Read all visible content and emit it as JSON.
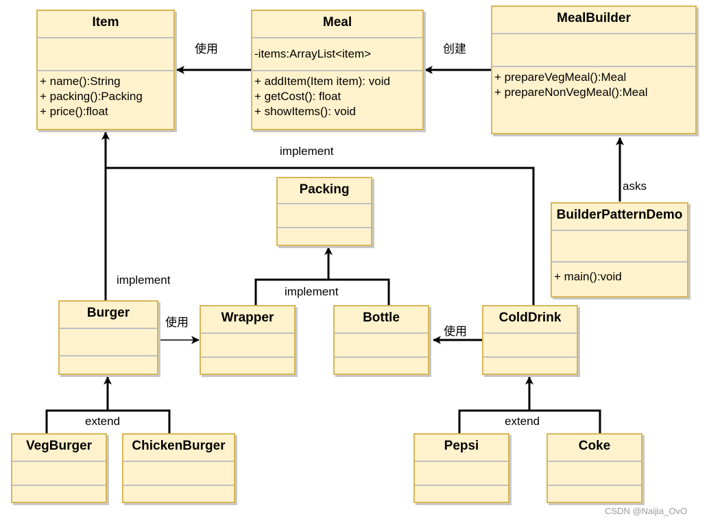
{
  "diagram": {
    "type": "UML class diagram",
    "colors": {
      "class_fill": "#fff2cc",
      "class_border": "#d6b656",
      "divider": "#c0c0c0",
      "line": "#000000"
    },
    "classes": {
      "item": {
        "name": "Item",
        "attributes": [],
        "methods": [
          "+ name():String",
          "+ packing():Packing",
          "+ price():float"
        ]
      },
      "meal": {
        "name": "Meal",
        "attributes": [
          "-items:ArrayList<item>"
        ],
        "methods": [
          "+ addItem(Item item): void",
          "+ getCost(): float",
          "+ showItems(): void"
        ]
      },
      "mealbuilder": {
        "name": "MealBuilder",
        "attributes": [],
        "methods": [
          "+ prepareVegMeal():Meal",
          "+ prepareNonVegMeal():Meal"
        ]
      },
      "packing": {
        "name": "Packing",
        "attributes": [],
        "methods": []
      },
      "builderpatterndemo": {
        "name": "BuilderPatternDemo",
        "attributes": [],
        "methods": [
          "+ main():void"
        ]
      },
      "burger": {
        "name": "Burger",
        "attributes": [],
        "methods": []
      },
      "wrapper": {
        "name": "Wrapper",
        "attributes": [],
        "methods": []
      },
      "bottle": {
        "name": "Bottle",
        "attributes": [],
        "methods": []
      },
      "colddrink": {
        "name": "ColdDrink",
        "attributes": [],
        "methods": []
      },
      "vegburger": {
        "name": "VegBurger",
        "attributes": [],
        "methods": []
      },
      "chickenburger": {
        "name": "ChickenBurger",
        "attributes": [],
        "methods": []
      },
      "pepsi": {
        "name": "Pepsi",
        "attributes": [],
        "methods": []
      },
      "coke": {
        "name": "Coke",
        "attributes": [],
        "methods": []
      }
    },
    "relations": {
      "meal_uses_item": {
        "from": "Meal",
        "to": "Item",
        "label": "使用"
      },
      "builder_creates_meal": {
        "from": "MealBuilder",
        "to": "Meal",
        "label": "创建"
      },
      "demo_asks_builder": {
        "from": "BuilderPatternDemo",
        "to": "MealBuilder",
        "label": "asks"
      },
      "top_implement": {
        "from": [
          "Burger",
          "ColdDrink"
        ],
        "to": "Item",
        "label": "implement"
      },
      "burger_implement": {
        "from": "Burger",
        "to": "Item",
        "label": "implement"
      },
      "packing_implement": {
        "from": [
          "Wrapper",
          "Bottle"
        ],
        "to": "Packing",
        "label": "implement"
      },
      "burger_uses_wrapper": {
        "from": "Burger",
        "to": "Wrapper",
        "label": "使用"
      },
      "colddrink_uses_bottle": {
        "from": "ColdDrink",
        "to": "Bottle",
        "label": "使用"
      },
      "burger_extend": {
        "from": [
          "VegBurger",
          "ChickenBurger"
        ],
        "to": "Burger",
        "label": "extend"
      },
      "colddrink_extend": {
        "from": [
          "Pepsi",
          "Coke"
        ],
        "to": "ColdDrink",
        "label": "extend"
      }
    }
  },
  "watermark": "CSDN @Naijia_OvO"
}
